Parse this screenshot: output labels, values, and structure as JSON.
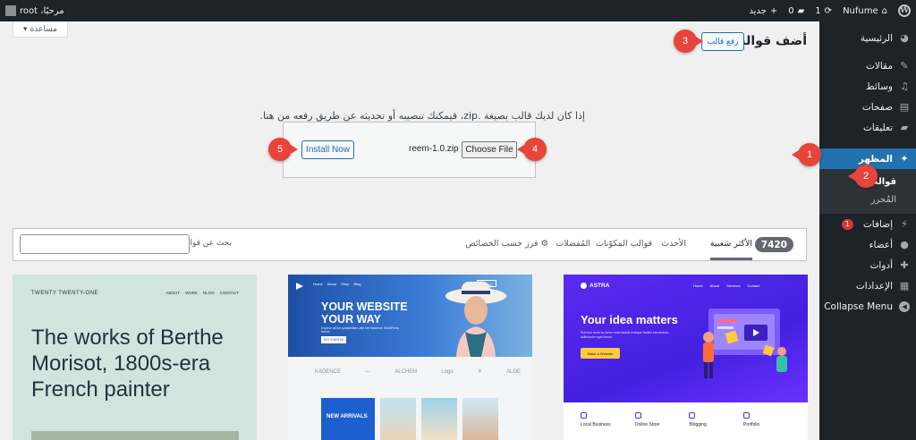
{
  "admin_bar": {
    "site_name": "Nufume",
    "updates_count": "1",
    "comments_count": "0",
    "new_label": "جديد",
    "greeting": "مرحبًا، root"
  },
  "sidebar": {
    "items": [
      {
        "label": "الرئيسية",
        "icon": "dashboard-icon"
      },
      {
        "label": "مقالات",
        "icon": "pin-icon"
      },
      {
        "label": "وسائط",
        "icon": "media-icon"
      },
      {
        "label": "صفحات",
        "icon": "page-icon"
      },
      {
        "label": "تعليقات",
        "icon": "comment-icon"
      },
      {
        "label": "المظهر",
        "icon": "appearance-icon"
      },
      {
        "label": "إضافات",
        "icon": "plugin-icon",
        "badge": "1"
      },
      {
        "label": "أعضاء",
        "icon": "user-icon"
      },
      {
        "label": "أدوات",
        "icon": "tools-icon"
      },
      {
        "label": "الإعدادات",
        "icon": "settings-icon"
      },
      {
        "label": "Collapse Menu",
        "icon": "collapse-icon"
      }
    ],
    "submenu": [
      "قوالب",
      "المُحرر"
    ]
  },
  "help_tab": {
    "label": "مساعدة"
  },
  "page": {
    "title": "أضف قوالب",
    "upload_theme_label": "رفع قالب",
    "upload_description": "إذا كان لديك قالب بصيغة .zip، فيمكنك تنصيبه أو تحديثه عن طريق رفعه من هنا.",
    "choose_file_label": "Choose File",
    "file_name": "reem-1.0.zip",
    "install_now_label": "Install Now"
  },
  "filter_bar": {
    "theme_count": "7420",
    "tabs": [
      "الأكثر شعبية",
      "الأحدث",
      "قوالب المكوّنات",
      "المُفضلات"
    ],
    "feature_filter_label": "فرز حسب الخصائص",
    "search_label": "بحث عن قوالب"
  },
  "themes": {
    "tt1": {
      "site_title": "TWENTY TWENTY-ONE",
      "nav": [
        "ABOUT",
        "WORK",
        "BLOG",
        "CONTACT"
      ],
      "heading": "The works of Berthe Morisot, 1800s-era French painter"
    },
    "kadence": {
      "nav": [
        "Home",
        "About",
        "Shop",
        "Blog"
      ],
      "nav_cta": "GET STARTED",
      "headline": "YOUR WEBSITE YOUR WAY",
      "subtext": "Explore all the possibilities with the Kadence WordPress theme",
      "button": "GET STARTED",
      "logos": [
        "KADENCE",
        "〰",
        "ALCHEM",
        "Logo",
        "✈",
        "ALOE"
      ],
      "arrivals": "NEW ARRIVALS"
    },
    "astra": {
      "logo": "ASTRA",
      "nav": [
        "Home",
        "About",
        "Services",
        "Contact"
      ],
      "headline": "Your idea matters",
      "subtext": "Pulvinar enim ac tortor nulla facilisi tristique facilisi elementum sollicitudin eget lorem.",
      "button": "Make a Website",
      "features": [
        "Local Business",
        "Online Store",
        "Blogging",
        "Portfolio"
      ]
    }
  },
  "markers": [
    "1",
    "2",
    "3",
    "4",
    "5"
  ],
  "colors": {
    "admin_dark": "#1d2327",
    "accent_blue": "#2271b1",
    "marker_red": "#e8443a",
    "astra_purple": "#5a2af0",
    "tt1_green": "#d1e4dd"
  }
}
